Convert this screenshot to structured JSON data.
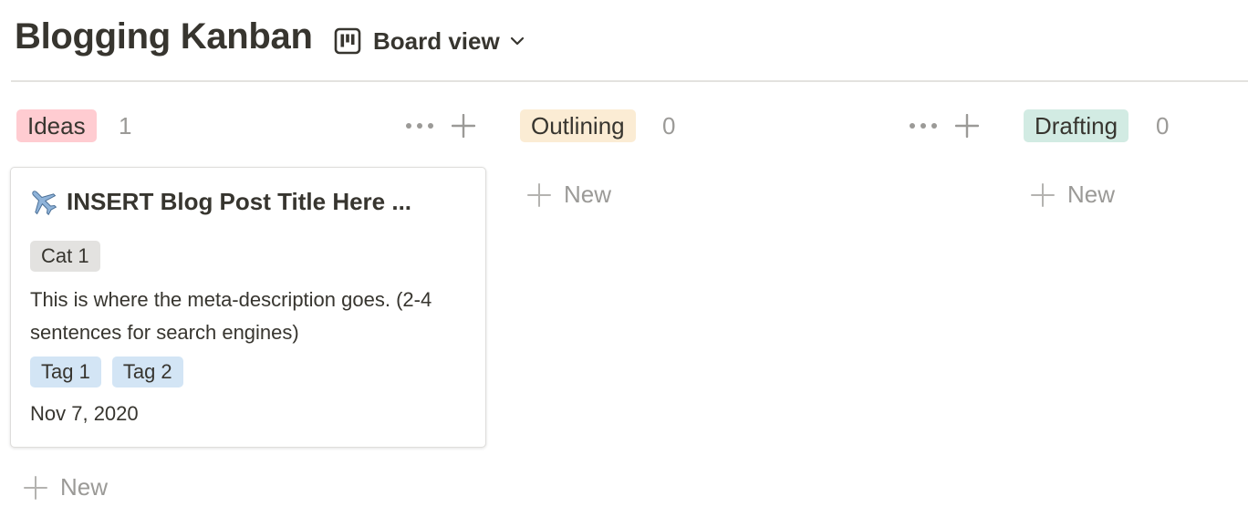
{
  "page": {
    "title": "Blogging Kanban",
    "view_label": "Board view",
    "view_icon": "board-icon"
  },
  "columns": [
    {
      "name": "Ideas",
      "count": "1",
      "pill_color": "#ffccd1",
      "new_label": "New",
      "cards": [
        {
          "icon": "airplane-icon",
          "title": "INSERT Blog Post Title Here ...",
          "category": "Cat 1",
          "description": "This is where the meta-description goes. (2-4 sentences for search engines)",
          "tags": [
            "Tag 1",
            "Tag 2"
          ],
          "date": "Nov 7, 2020"
        }
      ]
    },
    {
      "name": "Outlining",
      "count": "0",
      "pill_color": "#fbecd4",
      "new_label": "New",
      "cards": []
    },
    {
      "name": "Drafting",
      "count": "0",
      "pill_color": "#d2ebe3",
      "new_label": "New",
      "cards": []
    }
  ],
  "colors": {
    "text": "#37352f",
    "muted": "#9b9a97",
    "category_chip": "#e3e2e0",
    "tag_chip": "#d3e5f5"
  }
}
